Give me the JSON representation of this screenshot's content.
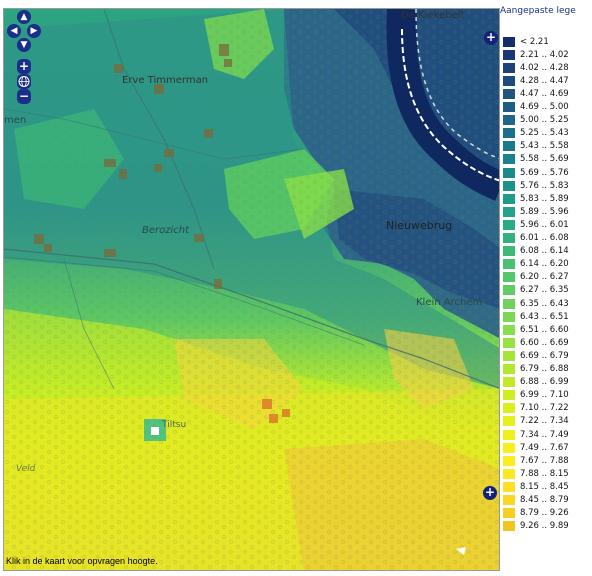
{
  "map": {
    "labels": {
      "de_kiekebelt": "De Kiekebelt",
      "erve_timmerman": "Erve Timmerman",
      "men": "men",
      "nieuwebrug": "Nieuwebrug",
      "berozicht": "Berozicht",
      "klein_archem": "Klein Archem",
      "veld": "Veld",
      "tiltsu": "Tiltsu"
    },
    "status_text": "Klik in de kaart voor opvragen hoogte."
  },
  "controls": {
    "pan_up": "▲",
    "pan_down": "▼",
    "pan_left": "◀",
    "pan_right": "▶",
    "zoom_in": "+",
    "zoom_out": "−",
    "world_icon": "globe-icon"
  },
  "legend": {
    "title": "Aangepaste lege",
    "expand_label": "+",
    "items": [
      {
        "label": "< 2.21",
        "color": "#142b6e"
      },
      {
        "label": "2.21 .. 4.02",
        "color": "#1a3773"
      },
      {
        "label": "4.02 .. 4.28",
        "color": "#1d4178"
      },
      {
        "label": "4.28 .. 4.47",
        "color": "#1f4a7d"
      },
      {
        "label": "4.47 .. 4.69",
        "color": "#205481"
      },
      {
        "label": "4.69 .. 5.00",
        "color": "#205d85"
      },
      {
        "label": "5.00 .. 5.25",
        "color": "#1f6688"
      },
      {
        "label": "5.25 .. 5.43",
        "color": "#1e6f8a"
      },
      {
        "label": "5.43 .. 5.58",
        "color": "#1c788c"
      },
      {
        "label": "5.58 .. 5.69",
        "color": "#1b818d"
      },
      {
        "label": "5.69 .. 5.76",
        "color": "#1a8a8d"
      },
      {
        "label": "5.76 .. 5.83",
        "color": "#1b928c"
      },
      {
        "label": "5.83 .. 5.89",
        "color": "#1e9b8a"
      },
      {
        "label": "5.89 .. 5.96",
        "color": "#23a387"
      },
      {
        "label": "5.96 .. 6.01",
        "color": "#2aab83"
      },
      {
        "label": "6.01 .. 6.08",
        "color": "#33b27e"
      },
      {
        "label": "6.08 .. 6.14",
        "color": "#3dba78"
      },
      {
        "label": "6.14 .. 6.20",
        "color": "#48c172"
      },
      {
        "label": "6.20 .. 6.27",
        "color": "#54c76b"
      },
      {
        "label": "6.27 .. 6.35",
        "color": "#60cd63"
      },
      {
        "label": "6.35 .. 6.43",
        "color": "#6ed35b"
      },
      {
        "label": "6.43 .. 6.51",
        "color": "#7bd853"
      },
      {
        "label": "6.51 .. 6.60",
        "color": "#89dd4a"
      },
      {
        "label": "6.60 .. 6.69",
        "color": "#97e141"
      },
      {
        "label": "6.69 .. 6.79",
        "color": "#a5e538"
      },
      {
        "label": "6.79 .. 6.88",
        "color": "#b3e830"
      },
      {
        "label": "6.88 .. 6.99",
        "color": "#c1eb28"
      },
      {
        "label": "6.99 .. 7.10",
        "color": "#cdee22"
      },
      {
        "label": "7.10 .. 7.22",
        "color": "#d9f01e"
      },
      {
        "label": "7.22 .. 7.34",
        "color": "#e4f11c"
      },
      {
        "label": "7.34 .. 7.49",
        "color": "#eef21c"
      },
      {
        "label": "7.49 .. 7.67",
        "color": "#f6f11e"
      },
      {
        "label": "7.67 .. 7.88",
        "color": "#fbed20"
      },
      {
        "label": "7.88 .. 8.15",
        "color": "#fde824"
      },
      {
        "label": "8.15 .. 8.45",
        "color": "#fde025"
      },
      {
        "label": "8.45 .. 8.79",
        "color": "#fbd724"
      },
      {
        "label": "8.79 .. 9.26",
        "color": "#f8ce22"
      },
      {
        "label": "9.26 .. 9.89",
        "color": "#f5c51f"
      }
    ]
  }
}
